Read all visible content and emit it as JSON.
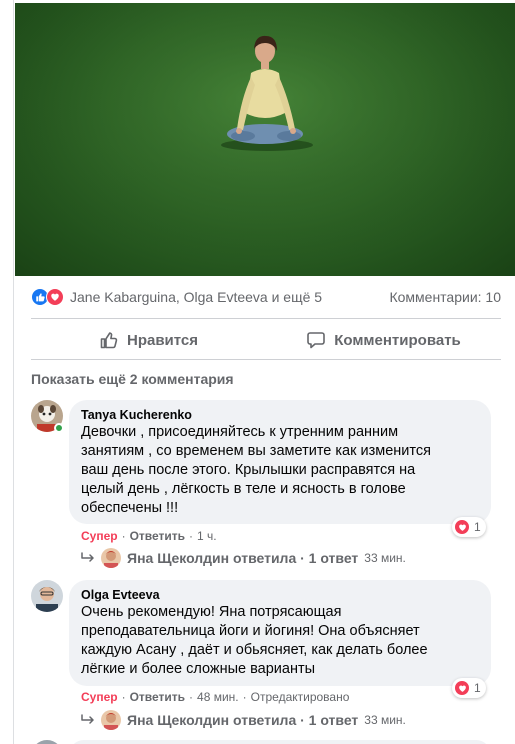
{
  "reactions": {
    "names": "Jane Kabarguina, Olga Evteeva и ещё 5",
    "comments_count": "Комментарии: 10"
  },
  "actions": {
    "like": "Нравится",
    "comment": "Комментировать"
  },
  "show_more": "Показать ещё 2 комментария",
  "comments": [
    {
      "author": "Tanya Kucherenko",
      "lines": [
        "Девочки , присоединяйтесь к утренним ранним",
        "занятиям , со временем вы заметите как изменится",
        "ваш день после этого. Крылышки расправятся на",
        "целый день , лёгкость в теле и ясность в голове",
        "обеспечены !!!"
      ],
      "reaction_count": "1",
      "super": "Супер",
      "reply": "Ответить",
      "time": "1 ч.",
      "edited": "",
      "replies_label": "Яна Щеколдин ответила · 1 ответ",
      "replies_time": "33 мин."
    },
    {
      "author": "Olga Evteeva",
      "lines": [
        "Очень рекомендую! Яна потрясающая",
        "преподавательница йоги и йогиня! Она объясняет",
        "каждую Асану , даёт и обьясняет, как делать более",
        "лёгкие и более сложные варианты"
      ],
      "reaction_count": "1",
      "super": "Супер",
      "reply": "Ответить",
      "time": "48 мин.",
      "edited": "Отредактировано",
      "replies_label": "Яна Щеколдин ответила · 1 ответ",
      "replies_time": "33 мин."
    }
  ],
  "colors": {
    "like_blue": "#1877f2",
    "love_red": "#f33e58",
    "online_green": "#31a24c",
    "bubble_gray": "#f0f2f5",
    "secondary_text": "#65676b"
  }
}
